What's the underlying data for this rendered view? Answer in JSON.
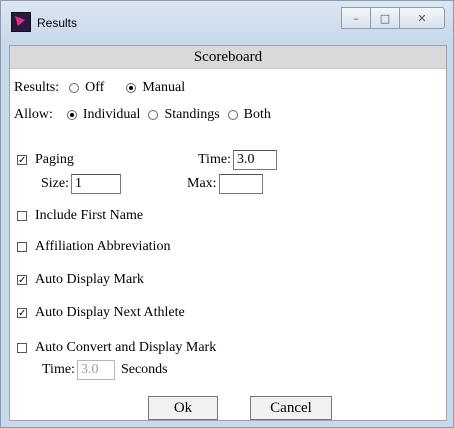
{
  "window": {
    "title": "Results",
    "minimize_glyph": "–",
    "maximize_glyph": "□",
    "close_glyph": "✕"
  },
  "header": {
    "title": "Scoreboard"
  },
  "results": {
    "label": "Results:",
    "options": [
      "Off",
      "Manual"
    ],
    "selected": "Manual"
  },
  "allow": {
    "label": "Allow:",
    "options": [
      "Individual",
      "Standings",
      "Both"
    ],
    "selected": "Individual"
  },
  "paging": {
    "label": "Paging",
    "checked": true,
    "time_label": "Time:",
    "time_value": "3.0",
    "size_label": "Size:",
    "size_value": "1",
    "max_label": "Max:",
    "max_value": ""
  },
  "options": [
    {
      "label": "Include First Name",
      "checked": false
    },
    {
      "label": "Affiliation Abbreviation",
      "checked": false
    },
    {
      "label": "Auto Display Mark",
      "checked": true
    },
    {
      "label": "Auto Display Next Athlete",
      "checked": true
    },
    {
      "label": "Auto Convert and Display Mark",
      "checked": false
    }
  ],
  "convert": {
    "time_label": "Time:",
    "time_value": "3.0",
    "seconds_label": "Seconds"
  },
  "buttons": {
    "ok": "Ok",
    "cancel": "Cancel"
  },
  "check_glyph": "✓"
}
